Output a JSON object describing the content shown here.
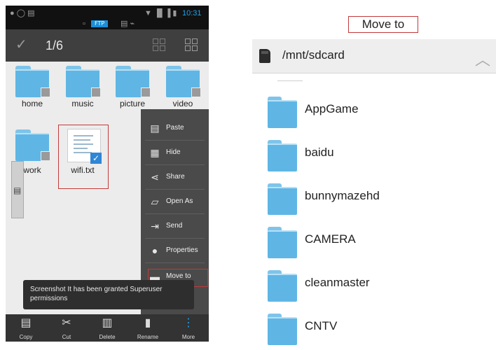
{
  "phone": {
    "status": {
      "ftp_label": "FTP",
      "time": "10:31"
    },
    "toolbar": {
      "selection_count": "1/6"
    },
    "files": [
      {
        "name": "home"
      },
      {
        "name": "music"
      },
      {
        "name": "picture"
      },
      {
        "name": "video"
      },
      {
        "name": "work"
      },
      {
        "name": "wifi.txt"
      }
    ],
    "context_menu": [
      {
        "label": "Paste",
        "icon": "paste-icon"
      },
      {
        "label": "Hide",
        "icon": "hide-icon"
      },
      {
        "label": "Share",
        "icon": "share-icon"
      },
      {
        "label": "Open As",
        "icon": "open-as-icon"
      },
      {
        "label": "Send",
        "icon": "send-icon"
      },
      {
        "label": "Properties",
        "icon": "properties-icon"
      },
      {
        "label": "Move to",
        "icon": "move-to-icon"
      }
    ],
    "toast": "Screenshot It has been granted Superuser permissions",
    "bottom_bar": [
      {
        "label": "Copy",
        "icon": "copy-icon"
      },
      {
        "label": "Cut",
        "icon": "cut-icon"
      },
      {
        "label": "Delete",
        "icon": "delete-icon"
      },
      {
        "label": "Rename",
        "icon": "rename-icon"
      },
      {
        "label": "More",
        "icon": "more-icon"
      }
    ]
  },
  "dialog": {
    "title": "Move to",
    "path": "/mnt/sdcard",
    "folders": [
      {
        "name": "AppGame"
      },
      {
        "name": "baidu"
      },
      {
        "name": "bunnymazehd"
      },
      {
        "name": "CAMERA"
      },
      {
        "name": "cleanmaster"
      },
      {
        "name": "CNTV"
      }
    ]
  },
  "colors": {
    "folder": "#5fb6e5",
    "highlight_border": "#c23a3a",
    "toolbar_bg": "#3f3f3f",
    "menu_bg": "#4a4a4a",
    "status_accent": "#1fa3e8"
  }
}
